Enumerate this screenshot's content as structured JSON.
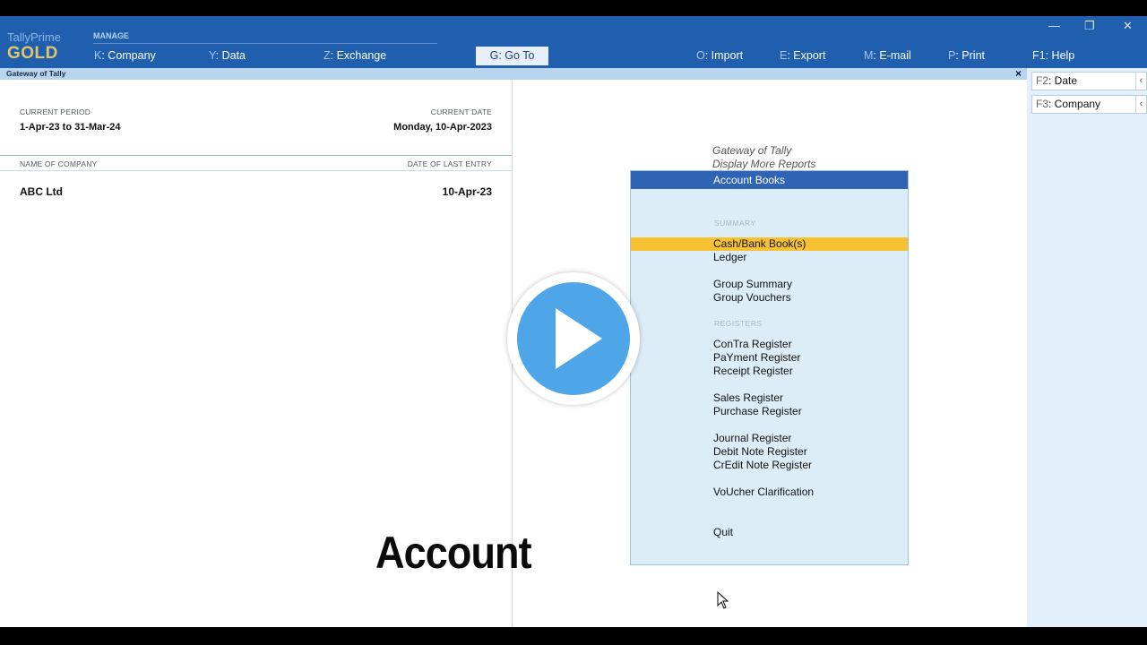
{
  "brand": {
    "line1": "TallyPrime",
    "line2": "GOLD"
  },
  "topmenu": {
    "group_label": "MANAGE",
    "company": {
      "key": "K",
      "label": ": Company"
    },
    "data": {
      "key": "Y",
      "label": ": Data"
    },
    "exchange": {
      "key": "Z",
      "label": ": Exchange"
    },
    "goto": {
      "key": "G",
      "label": ": Go To"
    },
    "import": {
      "key": "O",
      "label": ": Import"
    },
    "export": {
      "key": "E",
      "label": ": Export"
    },
    "email": {
      "key": "M",
      "label": ": E-mail"
    },
    "print": {
      "key": "P",
      "label": ": Print"
    },
    "help": {
      "key": "F1",
      "label": ": Help"
    }
  },
  "window": {
    "minimize": "—",
    "restore": "❐",
    "close": "✕"
  },
  "gateway_strip": {
    "title": "Gateway of Tally",
    "close": "×"
  },
  "left_panel": {
    "current_period_label": "CURRENT PERIOD",
    "current_period": "1-Apr-23 to 31-Mar-24",
    "current_date_label": "CURRENT DATE",
    "current_date": "Monday, 10-Apr-2023",
    "company_header": "NAME OF COMPANY",
    "last_entry_header": "DATE OF LAST ENTRY",
    "company_name": "ABC Ltd",
    "last_entry": "10-Apr-23"
  },
  "overlay_text": "Account",
  "breadcrumb": [
    "Gateway of Tally",
    "Display More Reports"
  ],
  "menu": {
    "title": "Account Books",
    "summary_label": "SUMMARY",
    "registers_label": "REGISTERS",
    "items": [
      "Cash/Bank Book(s)",
      "Ledger",
      "Group Summary",
      "Group Vouchers",
      "ConTra Register",
      "PaYment Register",
      "Receipt Register",
      "Sales Register",
      "Purchase Register",
      "Journal Register",
      "Debit Note Register",
      "CrEdit Note Register",
      "VoUcher Clarification",
      "Quit"
    ]
  },
  "side_buttons": [
    {
      "key": "F2",
      "label": ": Date"
    },
    {
      "key": "F3",
      "label": ": Company"
    }
  ],
  "colors": {
    "header": "#1f5fae",
    "menu_title": "#2f63b4",
    "selection": "#f7c231",
    "menu_bg": "#dcedf8",
    "play": "#4ea6e8"
  }
}
